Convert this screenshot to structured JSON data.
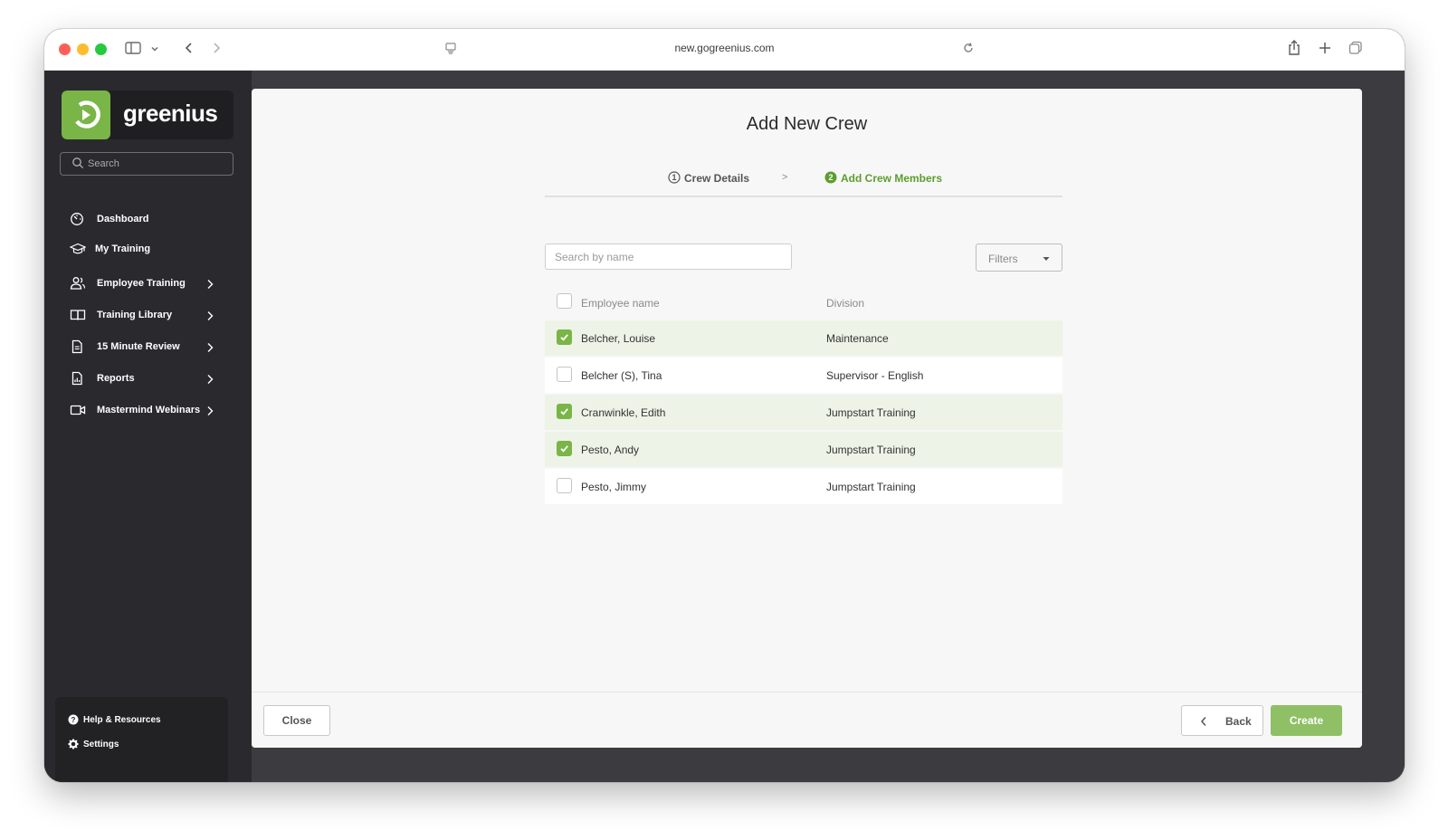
{
  "browser": {
    "url": "new.gogreenius.com"
  },
  "sidebar": {
    "logo_text": "greenius",
    "search_placeholder": "Search",
    "items": [
      {
        "label": "Dashboard",
        "icon": "dashboard-icon",
        "has_chevron": false
      },
      {
        "label": "My Training",
        "icon": "graduation-cap-icon",
        "has_chevron": false
      },
      {
        "label": "Employee Training",
        "icon": "users-icon",
        "has_chevron": true
      },
      {
        "label": "Training Library",
        "icon": "book-icon",
        "has_chevron": true
      },
      {
        "label": "15 Minute Review",
        "icon": "document-icon",
        "has_chevron": true
      },
      {
        "label": "Reports",
        "icon": "report-icon",
        "has_chevron": true
      },
      {
        "label": "Mastermind Webinars",
        "icon": "video-icon",
        "has_chevron": true
      }
    ],
    "bottom": [
      {
        "label": "Help & Resources",
        "icon": "help-icon"
      },
      {
        "label": "Settings",
        "icon": "gear-icon"
      }
    ]
  },
  "main": {
    "title": "Add New Crew",
    "steps": [
      {
        "number": "1",
        "label": "Crew Details",
        "active": false
      },
      {
        "number": "2",
        "label": "Add Crew Members",
        "active": true
      }
    ],
    "step_separator": ">",
    "search_placeholder": "Search by name",
    "filters_label": "Filters",
    "table": {
      "columns": [
        "Employee name",
        "Division"
      ],
      "rows": [
        {
          "name": "Belcher, Louise",
          "division": "Maintenance",
          "checked": true
        },
        {
          "name": "Belcher (S), Tina",
          "division": "Supervisor - English",
          "checked": false
        },
        {
          "name": "Cranwinkle, Edith",
          "division": "Jumpstart Training",
          "checked": true
        },
        {
          "name": "Pesto, Andy",
          "division": "Jumpstart Training",
          "checked": true
        },
        {
          "name": "Pesto, Jimmy",
          "division": "Jumpstart Training",
          "checked": false
        }
      ]
    }
  },
  "footer": {
    "close_label": "Close",
    "back_label": "Back",
    "create_label": "Create"
  },
  "colors": {
    "brand_green": "#7ab547",
    "active_step_green": "#5c9e2e",
    "create_button": "#8fc065",
    "sidebar_bg": "#2a2a2e",
    "selected_row_bg": "#edf3e6"
  }
}
